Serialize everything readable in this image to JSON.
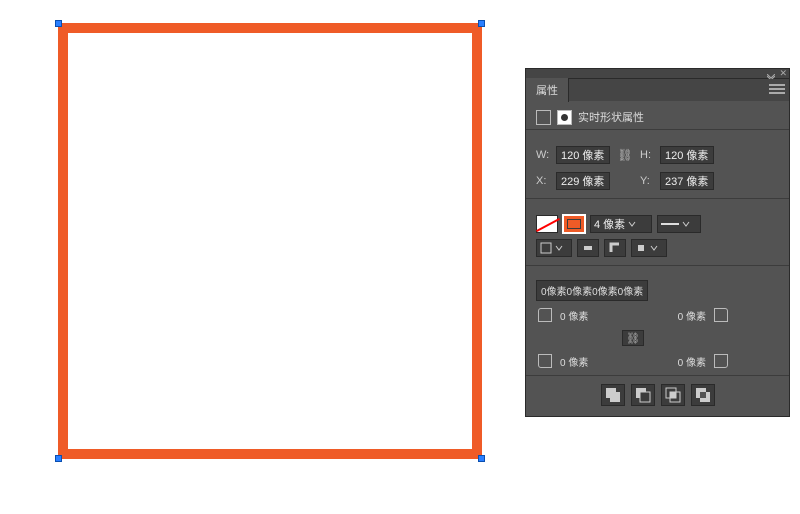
{
  "canvas": {
    "stroke_color": "#ef5b27"
  },
  "panel": {
    "tab_label": "属性",
    "header_label": "实时形状属性",
    "dims": {
      "w_label": "W:",
      "w_value": "120 像素",
      "h_label": "H:",
      "h_value": "120 像素",
      "x_label": "X:",
      "x_value": "229 像素",
      "y_label": "Y:",
      "y_value": "237 像素"
    },
    "stroke": {
      "width_value": "4 像素"
    },
    "corners": {
      "readout": "0像素0像素0像素0像素",
      "tl": "0 像素",
      "tr": "0 像素",
      "bl": "0 像素",
      "br": "0 像素"
    }
  }
}
